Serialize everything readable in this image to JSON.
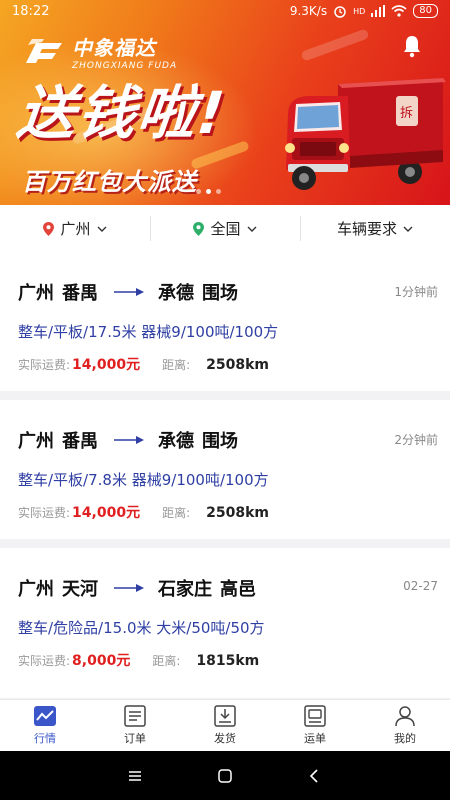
{
  "status_bar": {
    "time": "18:22",
    "speed": "9.3K/s",
    "signal": "HD",
    "battery": "80"
  },
  "banner": {
    "logo_cn": "中象福达",
    "logo_en": "ZHONGXIANG FUDA",
    "slogan": "送钱啦!",
    "subslogan": "百万红包大派送",
    "truck_sign": "拆",
    "active_slide": 2,
    "slide_count": 3
  },
  "filters": {
    "origin": "广州",
    "destination": "全国",
    "vehicle": "车辆要求"
  },
  "cards": [
    {
      "from_city": "广州",
      "from_district": "番禺",
      "to_city": "承德",
      "to_district": "围场",
      "time": "1分钟前",
      "spec": "整车/平板/17.5米  器械9/100吨/100方",
      "fee_label": "实际运费:",
      "fee": "14,000元",
      "dist_label": "距离:",
      "dist": "2508km"
    },
    {
      "from_city": "广州",
      "from_district": "番禺",
      "to_city": "承德",
      "to_district": "围场",
      "time": "2分钟前",
      "spec": "整车/平板/7.8米  器械9/100吨/100方",
      "fee_label": "实际运费:",
      "fee": "14,000元",
      "dist_label": "距离:",
      "dist": "2508km"
    },
    {
      "from_city": "广州",
      "from_district": "天河",
      "to_city": "石家庄",
      "to_district": "高邑",
      "time": "02-27",
      "spec": "整车/危险品/15.0米  大米/50吨/50方",
      "fee_label": "实际运费:",
      "fee": "8,000元",
      "dist_label": "距离:",
      "dist": "1815km"
    }
  ],
  "tabs": [
    {
      "label": "行情",
      "icon": "market-chart-icon",
      "active": true
    },
    {
      "label": "订单",
      "icon": "order-list-icon",
      "active": false
    },
    {
      "label": "发货",
      "icon": "ship-goods-icon",
      "active": false
    },
    {
      "label": "运单",
      "icon": "waybill-icon",
      "active": false
    },
    {
      "label": "我的",
      "icon": "profile-icon",
      "active": false
    }
  ],
  "colors": {
    "accent": "#3a56c9",
    "price": "#e02020",
    "spec": "#2f3fa3",
    "banner_red": "#e9401b"
  }
}
